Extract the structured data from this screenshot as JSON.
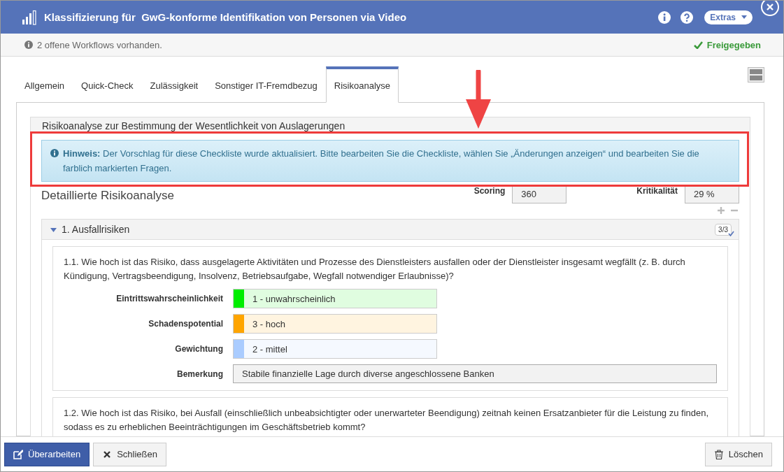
{
  "window": {
    "title": "Klassifizierung für  GwG-konforme Identifikation von Personen via Video",
    "extras_button": "Extras"
  },
  "status_bar": {
    "message": "2 offene Workflows vorhanden.",
    "status": "Freigegeben"
  },
  "tabs": [
    {
      "label": "Allgemein",
      "selected": false
    },
    {
      "label": "Quick-Check",
      "selected": false
    },
    {
      "label": "Zulässigkeit",
      "selected": false
    },
    {
      "label": "Sonstiger IT-Fremdbezug",
      "selected": false
    },
    {
      "label": "Risikoanalyse",
      "selected": true
    }
  ],
  "panel": {
    "heading": "Risikoanalyse zur Bestimmung der Wesentlichkeit von Auslagerungen",
    "hint": "**Hinweis:** Der Vorschlag für diese Checkliste wurde aktualisiert. Bitte bearbeiten Sie die Checkliste, wählen Sie „Änderungen anzeigen“ und bearbeiten Sie die farblich markierten Fragen.",
    "title": "Detaillierte Risikoanalyse",
    "scoring": {
      "label": "Scoring",
      "value": "360"
    },
    "criticality": {
      "label": "Kritikalität",
      "value": "29 %"
    }
  },
  "sections": [
    {
      "title": "1. Ausfallrisiken",
      "expanded": true,
      "badge": "3/3",
      "questions": [
        {
          "text": "1.1. Wie hoch ist das Risiko, dass ausgelagerte Aktivitäten und Prozesse des Dienstleisters ausfallen oder der Dienstleister insgesamt wegfällt (z. B. durch Kündigung, Vertragsbeendigung, Insolvenz, Betriebsaufgabe, Wegfall notwendiger Erlaubnisse)?",
          "fields": [
            {
              "kind": "rating",
              "label": "Eintrittswahrscheinlichkeit",
              "value": "1 - unwahrscheinlich",
              "color": "#00ee00"
            },
            {
              "kind": "rating",
              "label": "Schadenspotential",
              "value": "3 - hoch",
              "color": "#ffa500"
            },
            {
              "kind": "rating",
              "label": "Gewichtung",
              "value": "2 - mittel",
              "color": "#aaccff"
            },
            {
              "kind": "text",
              "label": "Bemerkung",
              "value": "Stabile finanzielle Lage durch diverse angeschlossene Banken"
            }
          ]
        },
        {
          "text": "1.2. Wie hoch ist das Risiko, bei Ausfall (einschließlich unbeabsichtigter oder unerwarteter Beendigung) zeitnah keinen Ersatzanbieter für die Leistung zu finden, sodass es zu erheblichen Beeinträchtigungen im Geschäftsbetrieb kommt?"
        }
      ]
    }
  ],
  "buttons": [
    {
      "label": "Überarbeiten",
      "kind": "primary"
    },
    {
      "label": "Schließen",
      "kind": "close"
    },
    {
      "label": "Löschen",
      "kind": "delete"
    }
  ]
}
